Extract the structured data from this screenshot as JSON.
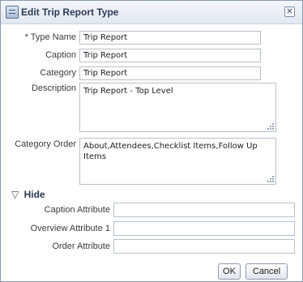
{
  "dialog": {
    "title": "Edit Trip Report Type",
    "close_glyph": "✕"
  },
  "icons": {
    "title": "form-icon",
    "close": "close-icon",
    "disclosure": "triangle-down-icon",
    "resize": "resize-grip-icon"
  },
  "form": {
    "type_name": {
      "required_mark": "*",
      "label": "Type Name",
      "value": "Trip Report"
    },
    "caption": {
      "label": "Caption",
      "value": "Trip Report"
    },
    "category": {
      "label": "Category",
      "value": "Trip Report"
    },
    "description": {
      "label": "Description",
      "value": "Trip Report - Top Level"
    },
    "category_order": {
      "label": "Category Order",
      "value": "About,Attendees,Checklist Items,Follow Up Items"
    }
  },
  "hide_section": {
    "toggle_glyph": "▽",
    "label": "Hide",
    "caption_attribute": {
      "label": "Caption Attribute",
      "value": ""
    },
    "overview_attribute_1": {
      "label": "Overview Attribute 1",
      "value": ""
    },
    "order_attribute": {
      "label": "Order Attribute",
      "value": ""
    }
  },
  "buttons": {
    "ok": "OK",
    "cancel": "Cancel"
  }
}
